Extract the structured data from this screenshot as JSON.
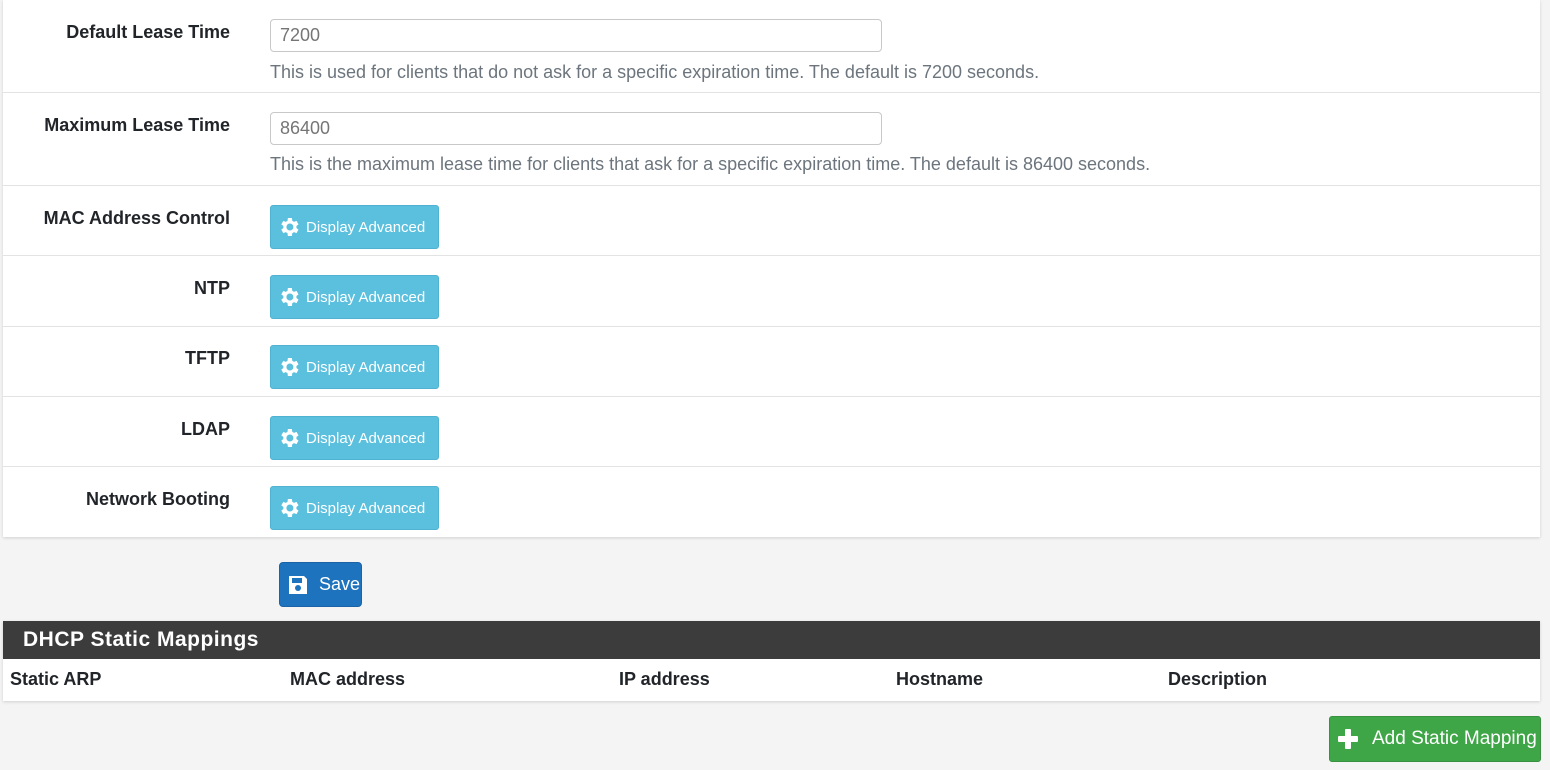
{
  "settings": {
    "default_lease": {
      "label": "Default Lease Time",
      "placeholder": "7200",
      "help": "This is used for clients that do not ask for a specific expiration time. The default is 7200 seconds."
    },
    "max_lease": {
      "label": "Maximum Lease Time",
      "placeholder": "86400",
      "help": "This is the maximum lease time for clients that ask for a specific expiration time. The default is 86400 seconds."
    },
    "advanced_rows": [
      {
        "label": "MAC Address Control",
        "button": "Display Advanced"
      },
      {
        "label": "NTP",
        "button": "Display Advanced"
      },
      {
        "label": "TFTP",
        "button": "Display Advanced"
      },
      {
        "label": "LDAP",
        "button": "Display Advanced"
      },
      {
        "label": "Network Booting",
        "button": "Display Advanced"
      }
    ]
  },
  "actions": {
    "save_label": "Save"
  },
  "static_mappings": {
    "title": "DHCP Static Mappings",
    "columns": [
      "Static ARP",
      "MAC address",
      "IP address",
      "Hostname",
      "Description"
    ],
    "add_label": "Add Static Mapping"
  },
  "colors": {
    "info_button": "#5bc0de",
    "primary_button": "#1e73be",
    "success_button": "#3fa648",
    "panel_header": "#3c3c3c"
  }
}
